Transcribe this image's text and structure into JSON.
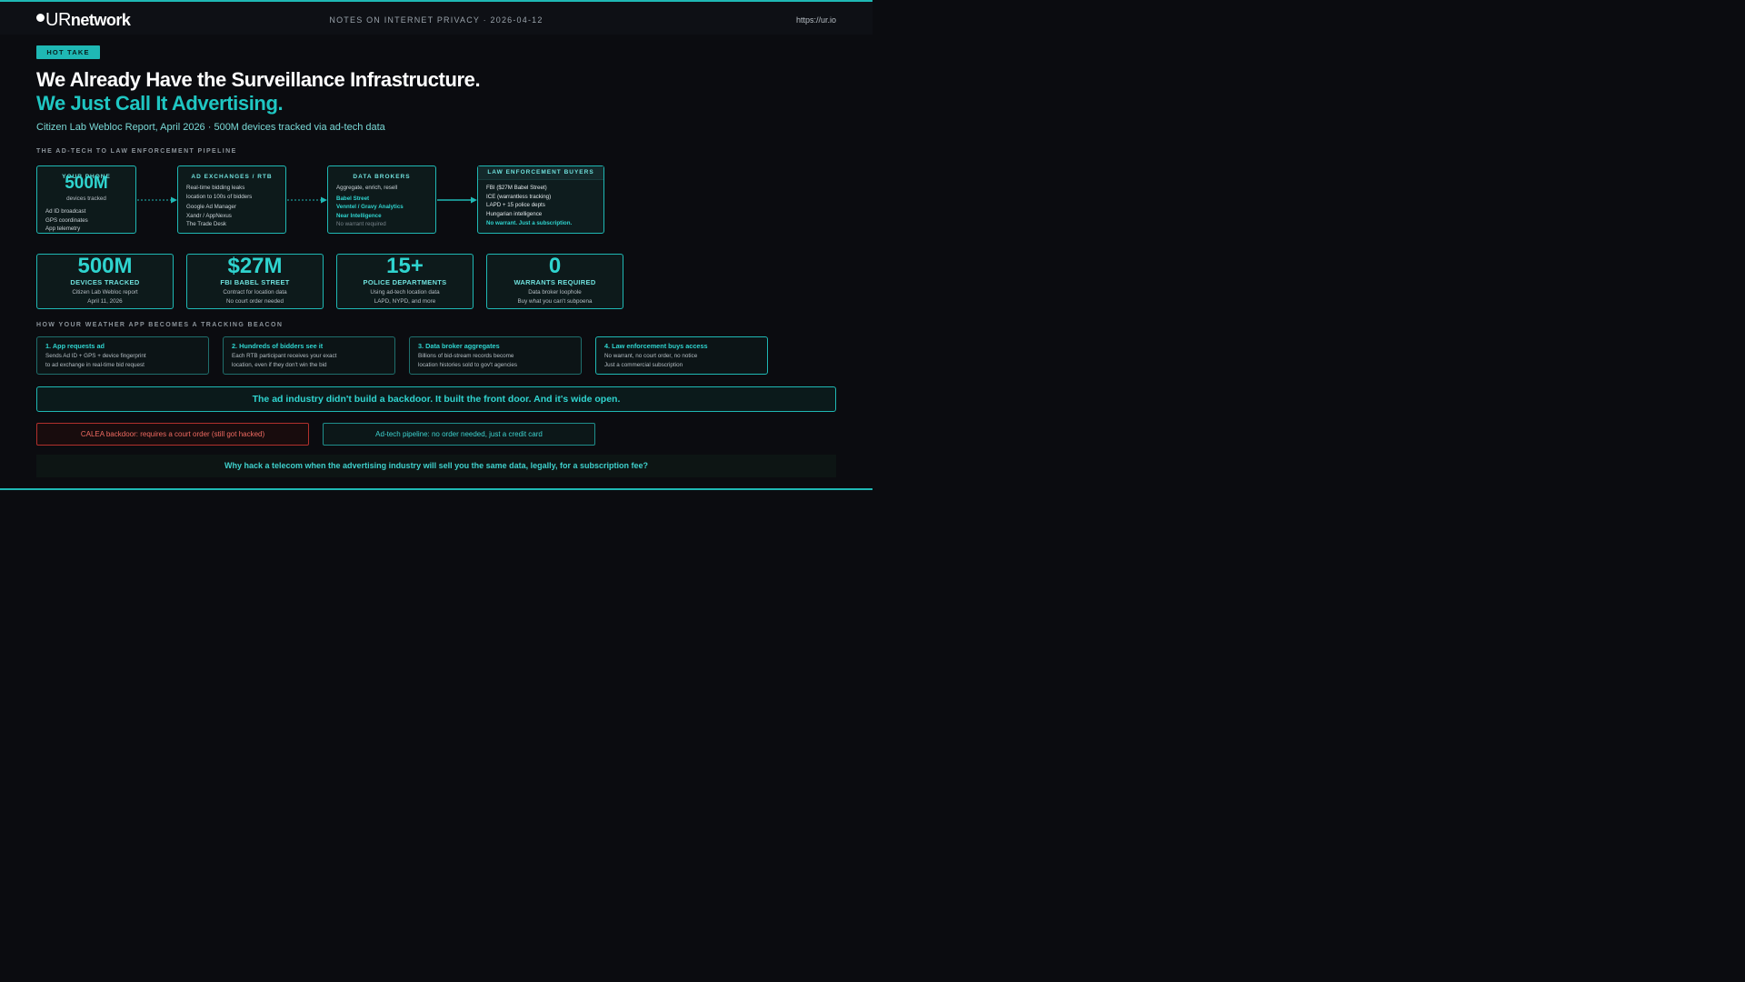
{
  "header": {
    "logo_ur": "UR",
    "logo_net": "network",
    "center": "NOTES ON INTERNET PRIVACY  ·  2026-04-12",
    "url": "https://ur.io"
  },
  "tag": "HOT TAKE",
  "title_line1": "We Already Have the Surveillance Infrastructure.",
  "title_line2": "We Just Call It Advertising.",
  "subtitle": "Citizen Lab Webloc Report, April 2026 · 500M devices tracked via ad-tech data",
  "pipeline": {
    "label": "THE AD-TECH TO LAW ENFORCEMENT PIPELINE",
    "source": {
      "title": "YOUR PHONE",
      "big": "500M",
      "caption": "devices tracked",
      "lines": [
        "Ad ID broadcast",
        "GPS coordinates",
        "App telemetry"
      ]
    },
    "exchanges": {
      "title": "AD EXCHANGES / RTB",
      "desc": [
        "Real-time bidding leaks",
        "location to 100s of bidders"
      ],
      "lines": [
        "Google Ad Manager",
        "Xandr / AppNexus",
        "The Trade Desk"
      ]
    },
    "brokers": {
      "title": "DATA BROKERS",
      "desc": "Aggregate, enrich, resell",
      "highlights": [
        "Babel Street",
        "Venntel / Gravy Analytics",
        "Near Intelligence"
      ],
      "note": "No warrant required"
    },
    "buyers": {
      "title": "LAW ENFORCEMENT BUYERS",
      "lines": [
        "FBI ($27M Babel Street)",
        "ICE (warrantless tracking)",
        "LAPD + 15 police depts",
        "Hungarian intelligence"
      ],
      "note": "No warrant. Just a subscription."
    }
  },
  "stats": [
    {
      "num": "500M",
      "label": "DEVICES TRACKED",
      "d1": "Citizen Lab Webloc report",
      "d2": "April 11, 2026"
    },
    {
      "num": "$27M",
      "label": "FBI BABEL STREET",
      "d1": "Contract for location data",
      "d2": "No court order needed"
    },
    {
      "num": "15+",
      "label": "POLICE DEPARTMENTS",
      "d1": "Using ad-tech location data",
      "d2": "LAPD, NYPD, and more"
    },
    {
      "num": "0",
      "label": "WARRANTS REQUIRED",
      "d1": "Data broker loophole",
      "d2": "Buy what you can't subpoena"
    }
  ],
  "steps_label": "HOW YOUR WEATHER APP BECOMES A TRACKING BEACON",
  "steps": [
    {
      "title": "1. App requests ad",
      "l1": "Sends Ad ID + GPS + device fingerprint",
      "l2": "to ad exchange in real-time bid request"
    },
    {
      "title": "2. Hundreds of bidders see it",
      "l1": "Each RTB participant receives your exact",
      "l2": "location, even if they don't win the bid"
    },
    {
      "title": "3. Data broker aggregates",
      "l1": "Billions of bid-stream records become",
      "l2": "location histories sold to gov't agencies"
    },
    {
      "title": "4. Law enforcement buys access",
      "l1": "No warrant, no court order, no notice",
      "l2": "Just a commercial subscription"
    }
  ],
  "banner": "The ad industry didn't build a backdoor. It built the front door. And it's wide open.",
  "compare": {
    "calea": "CALEA backdoor: requires a court order (still got hacked)",
    "adtech": "Ad-tech pipeline: no order needed, just a credit card"
  },
  "quote": "Why hack a telecom when the advertising industry will sell you the same data, legally, for a subscription fee?",
  "colors": {
    "accent": "#1fb8b4",
    "warning": "#ef6a61",
    "background": "#0b0c10"
  }
}
